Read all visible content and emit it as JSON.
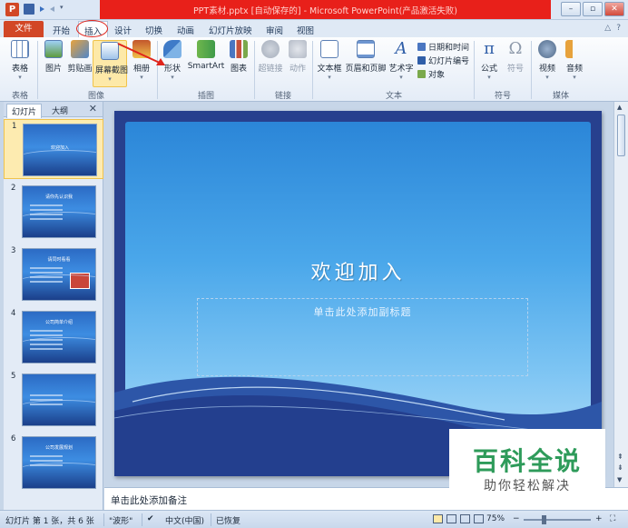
{
  "window": {
    "title": "PPT素材.pptx [自动保存的] - Microsoft PowerPoint(产品激活失败)",
    "app_logo": "P",
    "controls": [
      "minimize-icon",
      "restore-icon",
      "close-icon"
    ]
  },
  "tabs": {
    "file": "文件",
    "items": [
      "开始",
      "插入",
      "设计",
      "切换",
      "动画",
      "幻灯片放映",
      "审阅",
      "视图"
    ],
    "active": "插入"
  },
  "ribbon": {
    "buttons": {
      "table": "表格",
      "picture": "图片",
      "clipart": "剪贴画",
      "screenshot": "屏幕截图",
      "album": "相册",
      "shapes": "形状",
      "smartart": "SmartArt",
      "chart": "图表",
      "hyperlink": "超链接",
      "action": "动作",
      "textbox": "文本框",
      "header_footer": "页眉和页脚",
      "wordart": "艺术字",
      "datetime": "日期和时间",
      "slide_number": "幻灯片编号",
      "object": "对象",
      "equation": "公式",
      "symbol": "符号",
      "video": "视频",
      "audio": "音频"
    },
    "groups": {
      "tables": "表格",
      "images": "图像",
      "illustrations": "插图",
      "links": "链接",
      "text": "文本",
      "symbols": "符号",
      "media": "媒体"
    },
    "symbols": {
      "pi": "π",
      "omega": "Ω"
    }
  },
  "left_pane": {
    "tabs": [
      "幻灯片",
      "大纲"
    ],
    "close": "✕",
    "slides": [
      {
        "num": "1",
        "title": "欢迎加入"
      },
      {
        "num": "2",
        "title": "请你先认识我"
      },
      {
        "num": "3",
        "title": "请同时看看"
      },
      {
        "num": "4",
        "title": "公司简单介绍"
      },
      {
        "num": "5",
        "title": ""
      },
      {
        "num": "6",
        "title": "公司发展规划"
      }
    ]
  },
  "slide": {
    "title": "欢迎加入",
    "subtitle_placeholder": "单击此处添加副标题"
  },
  "notes": {
    "placeholder": "单击此处添加备注"
  },
  "statusbar": {
    "slide_info": "幻灯片 第 1 张，共 6 张",
    "theme": "\"波形\"",
    "language": "中文(中国)",
    "recovered": "已恢复",
    "zoom": "75%",
    "zoom_minus": "−",
    "zoom_plus": "+"
  },
  "watermark": {
    "brand": "百科全说",
    "tagline": "助你轻松解决"
  }
}
